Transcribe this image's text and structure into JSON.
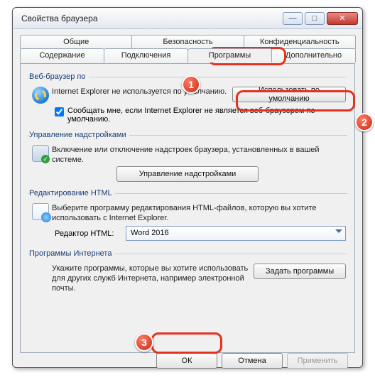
{
  "window": {
    "title": "Свойства браузера"
  },
  "tabs": {
    "row1": [
      "Общие",
      "Безопасность",
      "Конфиденциальность"
    ],
    "row2": [
      "Содержание",
      "Подключения",
      "Программы",
      "Дополнительно"
    ],
    "active": "Программы"
  },
  "sections": {
    "browser": {
      "legend": "Веб-браузер по",
      "text": "Internet Explorer не используется по умолчанию.",
      "set_default_btn": "Использовать по умолчанию",
      "notify_label": "Сообщать мне, если Internet Explorer не является веб-браузером по умолчанию.",
      "notify_checked": true
    },
    "addons": {
      "legend": "Управление надстройками",
      "text": "Включение или отключение надстроек браузера, установленных в вашей системе.",
      "manage_btn": "Управление надстройками"
    },
    "html_edit": {
      "legend": "Редактирование HTML",
      "text": "Выберите программу редактирования HTML-файлов, которую вы хотите использовать с Internet Explorer.",
      "editor_label": "Редактор HTML:",
      "editor_value": "Word 2016"
    },
    "internet_programs": {
      "legend": "Программы Интернета",
      "text": "Укажите программы, которые вы хотите использовать для других служб Интернета, например электронной почты.",
      "set_programs_btn": "Задать программы"
    }
  },
  "footer": {
    "ok": "ОК",
    "cancel": "Отмена",
    "apply": "Применить"
  },
  "badges": {
    "b1": "1",
    "b2": "2",
    "b3": "3"
  }
}
